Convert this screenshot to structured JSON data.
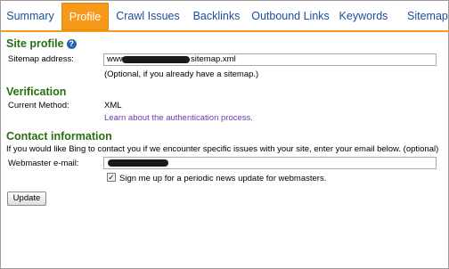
{
  "tabs": [
    "Summary",
    "Profile",
    "Crawl Issues",
    "Backlinks",
    "Outbound Links",
    "Keywords",
    "Sitemaps"
  ],
  "active_tab": "Profile",
  "site_profile": {
    "title": "Site profile",
    "sitemap_label": "Sitemap address:",
    "sitemap_prefix": "www",
    "sitemap_suffix": "sitemap.xml",
    "sitemap_hint": "(Optional, if you already have a sitemap.)"
  },
  "verification": {
    "title": "Verification",
    "method_label": "Current Method:",
    "method_value": "XML",
    "learn_link": "Learn about the authentication process."
  },
  "contact": {
    "title": "Contact information",
    "description": "If you would like Bing to contact you if we encounter specific issues with your site, enter your email below. (optional)",
    "email_label": "Webmaster e-mail:",
    "newsletter_label": "Sign me up for a periodic news update for webmasters.",
    "newsletter_checked": true
  },
  "update_label": "Update",
  "colors": {
    "tab_active": "#f79a1b",
    "section_title": "#2a6e12",
    "link": "#6a3bb0",
    "tab_text": "#1c4d9a"
  }
}
